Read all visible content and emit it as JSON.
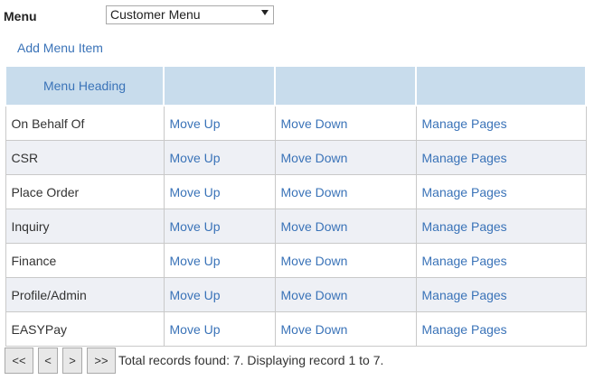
{
  "menu": {
    "label": "Menu",
    "selected": "Customer Menu"
  },
  "add_menu_item": "Add Menu Item",
  "table": {
    "headers": [
      "Menu Heading",
      "",
      "",
      ""
    ],
    "rows": [
      {
        "name": "On Behalf Of",
        "up": "Move Up",
        "down": "Move Down",
        "pages": "Manage Pages"
      },
      {
        "name": "CSR",
        "up": "Move Up",
        "down": "Move Down",
        "pages": "Manage Pages"
      },
      {
        "name": "Place Order",
        "up": "Move Up",
        "down": "Move Down",
        "pages": "Manage Pages"
      },
      {
        "name": "Inquiry",
        "up": "Move Up",
        "down": "Move Down",
        "pages": "Manage Pages"
      },
      {
        "name": "Finance",
        "up": "Move Up",
        "down": "Move Down",
        "pages": "Manage Pages"
      },
      {
        "name": "Profile/Admin",
        "up": "Move Up",
        "down": "Move Down",
        "pages": "Manage Pages"
      },
      {
        "name": "EASYPay",
        "up": "Move Up",
        "down": "Move Down",
        "pages": "Manage Pages"
      }
    ]
  },
  "pager": {
    "first": "<<",
    "prev": "<",
    "next": ">",
    "last": ">>",
    "info": "Total records found: 7. Displaying record 1 to 7."
  }
}
